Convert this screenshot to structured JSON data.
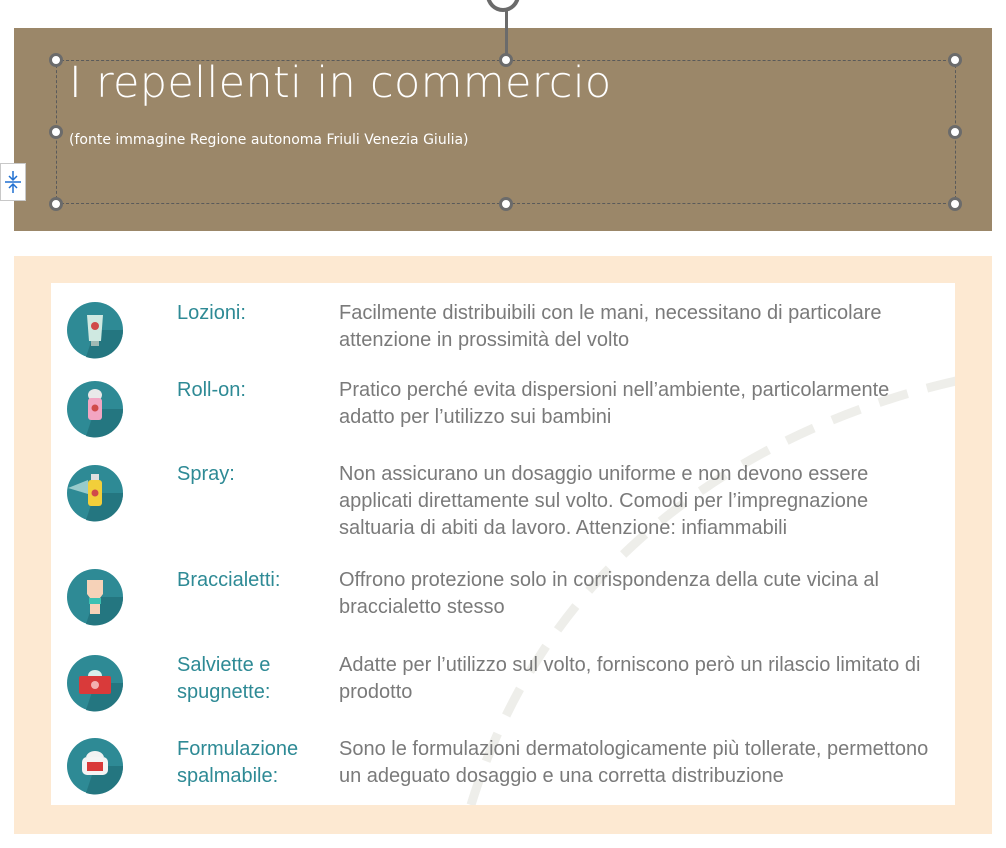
{
  "slide": {
    "title": "I repellenti in commercio",
    "subtitle": "(fonte immagine Regione autonoma Friuli Venezia Giulia)"
  },
  "colors": {
    "title_band": "#9b8769",
    "panel_bg": "#fde9d2",
    "label": "#2e8a95",
    "desc": "#7a7a7a",
    "icon_circle": "#2e8a95"
  },
  "items": [
    {
      "label": "Lozioni:",
      "description": "Facilmente distribuibili con le mani, necessitano di particolare attenzione in prossimità del volto",
      "icon": "lotion-tube-icon"
    },
    {
      "label": "Roll-on:",
      "description": "Pratico perché evita dispersioni nell’ambiente, particolarmente adatto per l’utilizzo sui bambini",
      "icon": "roll-on-icon"
    },
    {
      "label": "Spray:",
      "description": "Non assicurano un dosaggio uniforme e non devono essere applicati direttamente sul volto. Comodi per l’impregnazione saltuaria di abiti da lavoro. Attenzione: infiammabili",
      "icon": "spray-can-icon"
    },
    {
      "label": "Braccialetti:",
      "description": "Offrono protezione solo in corrispondenza della cute vicina al braccialetto stesso",
      "icon": "wristband-icon"
    },
    {
      "label": "Salviette e spugnette:",
      "description": "Adatte per l’utilizzo sul volto, forniscono però un rilascio limitato di prodotto",
      "icon": "wipes-box-icon"
    },
    {
      "label": "Formulazione spalmabile:",
      "description": "Sono le formulazioni dermatologicamente più tollerate, permettono un adeguato dosaggio e una corretta distribuzione",
      "icon": "cream-jar-icon"
    }
  ]
}
